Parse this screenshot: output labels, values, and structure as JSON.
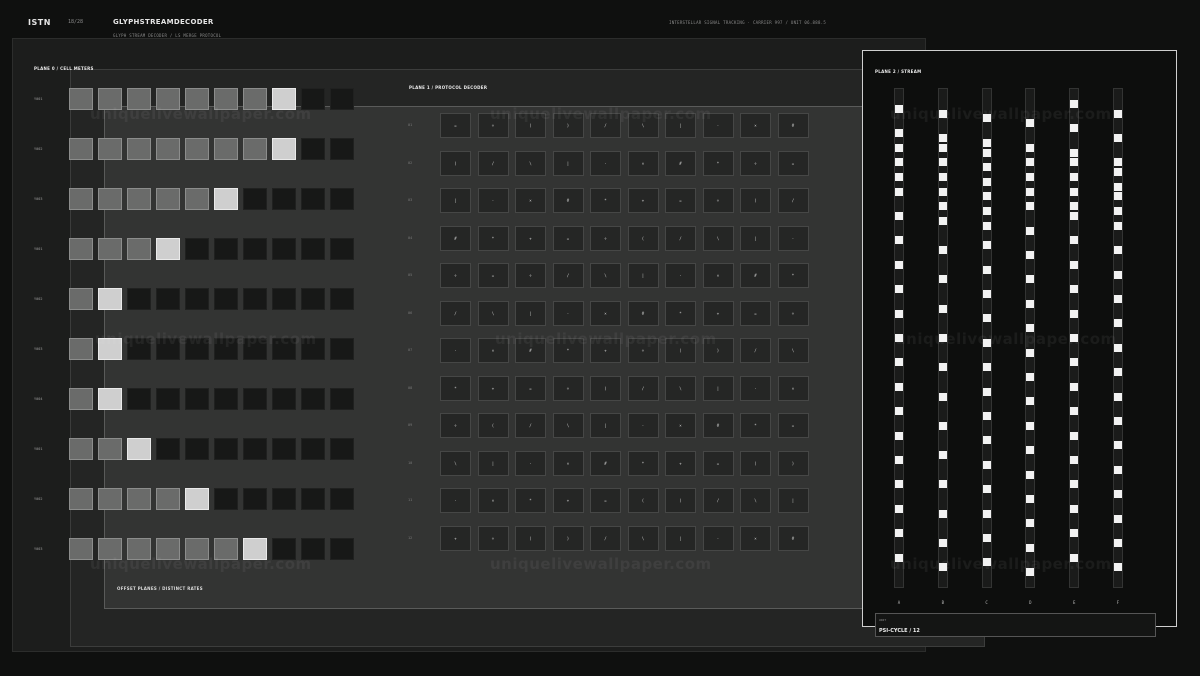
{
  "header": {
    "brand": "ISTN",
    "counter": "18/28",
    "title": "GLYPHSTREAMDECODER",
    "subtitle": "GLYPH STREAM DECODER  /  LS MERGE PROTOCOL",
    "right_info": "INTERSTELLAR SIGNAL TRACKING  ·  CARRIER 997  /  UNIT 06.888.5"
  },
  "plane0": {
    "label": "PLANE 0  /  CELL METERS",
    "footer": "OFFSET PLANES  /  DISTINCT RATES",
    "rows": [
      {
        "label": "Y001",
        "level": 7
      },
      {
        "label": "Y002",
        "level": 7
      },
      {
        "label": "Y003",
        "level": 5
      },
      {
        "label": "Y001",
        "level": 3
      },
      {
        "label": "Y002",
        "level": 1
      },
      {
        "label": "Y003",
        "level": 1
      },
      {
        "label": "Y004",
        "level": 1
      },
      {
        "label": "Y001",
        "level": 2
      },
      {
        "label": "Y002",
        "level": 4
      },
      {
        "label": "Y003",
        "level": 6
      }
    ],
    "cells_per_row": 10
  },
  "plane1": {
    "label": "PLANE 1  /  PROTOCOL DECODER",
    "row_labels": [
      "01",
      "02",
      "03",
      "04",
      "05",
      "06",
      "07",
      "08",
      "09",
      "10",
      "11",
      "12"
    ],
    "grid": [
      [
        "=",
        "÷",
        "(",
        ")",
        "/",
        "\\",
        "|",
        "·",
        "×",
        "#"
      ],
      [
        ")",
        "/",
        "\\",
        "|",
        "·",
        "×",
        "#",
        "*",
        "÷",
        "="
      ],
      [
        "|",
        "·",
        "×",
        "#",
        "*",
        "+",
        "=",
        "÷",
        ")",
        "/"
      ],
      [
        "#",
        "*",
        "+",
        "=",
        "÷",
        "(",
        "/",
        "\\",
        "|",
        "·"
      ],
      [
        "÷",
        "=",
        "÷",
        "/",
        "\\",
        "|",
        "·",
        "×",
        "#",
        "*"
      ],
      [
        "/",
        "\\",
        "|",
        "·",
        "×",
        "#",
        "*",
        "+",
        "=",
        "÷"
      ],
      [
        "·",
        "×",
        "#",
        "*",
        "+",
        "÷",
        "(",
        ")",
        "/",
        "\\"
      ],
      [
        "*",
        "+",
        "=",
        "÷",
        ")",
        "/",
        "\\",
        "|",
        "·",
        "×"
      ],
      [
        "÷",
        "(",
        "/",
        "\\",
        "|",
        "·",
        "×",
        "#",
        "*",
        "="
      ],
      [
        "\\",
        "|",
        "·",
        "×",
        "#",
        "*",
        "+",
        "=",
        "(",
        ")"
      ],
      [
        "·",
        "×",
        "*",
        "+",
        "=",
        "(",
        ")",
        "/",
        "\\",
        "|"
      ],
      [
        "+",
        "÷",
        "(",
        ")",
        "/",
        "\\",
        "|",
        "·",
        "×",
        "#"
      ]
    ]
  },
  "plane2": {
    "label": "PLANE 2  /  STREAM",
    "columns": [
      {
        "label": "A",
        "blips": [
          0.03,
          0.08,
          0.11,
          0.14,
          0.17,
          0.2,
          0.25,
          0.3,
          0.35,
          0.4,
          0.45,
          0.5,
          0.55,
          0.6,
          0.65,
          0.7,
          0.75,
          0.8,
          0.85,
          0.9,
          0.95
        ]
      },
      {
        "label": "B",
        "blips": [
          0.04,
          0.09,
          0.11,
          0.14,
          0.17,
          0.2,
          0.23,
          0.26,
          0.32,
          0.38,
          0.44,
          0.5,
          0.56,
          0.62,
          0.68,
          0.74,
          0.8,
          0.86,
          0.92,
          0.97
        ]
      },
      {
        "label": "C",
        "blips": [
          0.05,
          0.1,
          0.12,
          0.15,
          0.18,
          0.21,
          0.24,
          0.27,
          0.31,
          0.36,
          0.41,
          0.46,
          0.51,
          0.56,
          0.61,
          0.66,
          0.71,
          0.76,
          0.81,
          0.86,
          0.91,
          0.96
        ]
      },
      {
        "label": "D",
        "blips": [
          0.06,
          0.11,
          0.14,
          0.17,
          0.2,
          0.23,
          0.28,
          0.33,
          0.38,
          0.43,
          0.48,
          0.53,
          0.58,
          0.63,
          0.68,
          0.73,
          0.78,
          0.83,
          0.88,
          0.93,
          0.98
        ]
      },
      {
        "label": "E",
        "blips": [
          0.02,
          0.07,
          0.12,
          0.14,
          0.17,
          0.2,
          0.23,
          0.25,
          0.3,
          0.35,
          0.4,
          0.45,
          0.5,
          0.55,
          0.6,
          0.65,
          0.7,
          0.75,
          0.8,
          0.85,
          0.9,
          0.95
        ]
      },
      {
        "label": "F",
        "blips": [
          0.04,
          0.09,
          0.14,
          0.16,
          0.19,
          0.21,
          0.24,
          0.27,
          0.32,
          0.37,
          0.42,
          0.47,
          0.52,
          0.57,
          0.62,
          0.67,
          0.72,
          0.77,
          0.82,
          0.87,
          0.92,
          0.97
        ]
      }
    ],
    "status_tag": "UNIT",
    "status": "PSI-CYCLE / 12"
  },
  "watermark": "uniquelivewallpaper.com"
}
